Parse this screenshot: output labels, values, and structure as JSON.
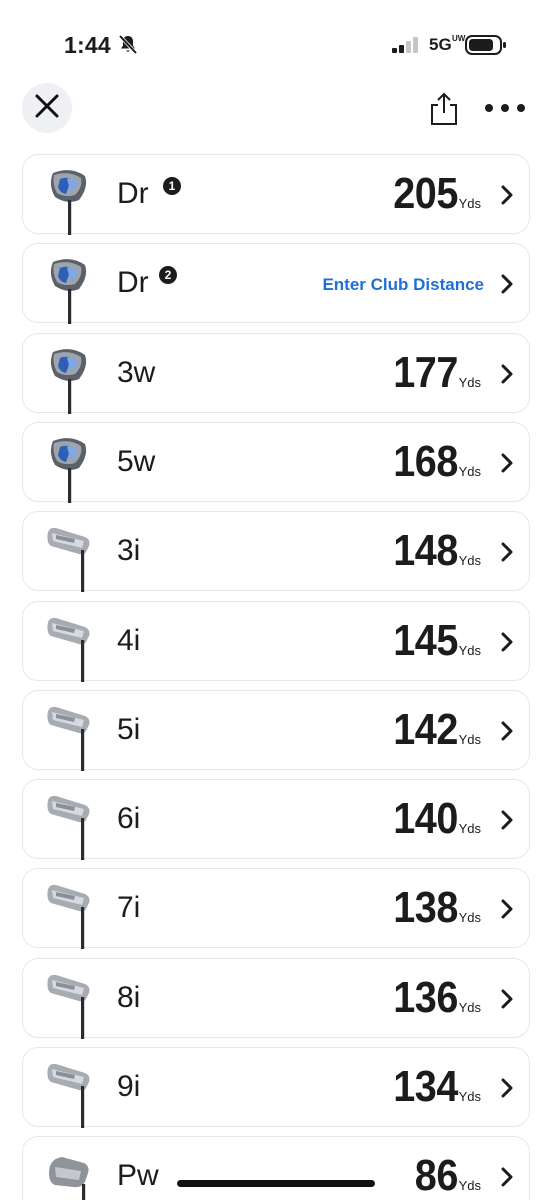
{
  "status_bar": {
    "time": "1:44",
    "network": "5G",
    "network_sup": "UW",
    "icons": [
      "bell-slash-icon",
      "signal-icon",
      "battery-icon"
    ]
  },
  "nav": {
    "icons": [
      "close-icon",
      "share-icon",
      "more-icon"
    ]
  },
  "colors": {
    "link": "#1f6fd6",
    "row_border": "#e6e8ec",
    "close_bg": "#eef0f4",
    "text": "#1c1c1e"
  },
  "clubs": [
    {
      "name": "Dr",
      "badge": "1",
      "type": "driver",
      "distance": "205",
      "unit": "Yds",
      "link": ""
    },
    {
      "name": "Dr",
      "badge": "2",
      "type": "driver",
      "distance": "",
      "unit": "",
      "link": "Enter Club Distance"
    },
    {
      "name": "3w",
      "badge": "",
      "type": "driver",
      "distance": "177",
      "unit": "Yds",
      "link": ""
    },
    {
      "name": "5w",
      "badge": "",
      "type": "driver",
      "distance": "168",
      "unit": "Yds",
      "link": ""
    },
    {
      "name": "3i",
      "badge": "",
      "type": "iron",
      "distance": "148",
      "unit": "Yds",
      "link": ""
    },
    {
      "name": "4i",
      "badge": "",
      "type": "iron",
      "distance": "145",
      "unit": "Yds",
      "link": ""
    },
    {
      "name": "5i",
      "badge": "",
      "type": "iron",
      "distance": "142",
      "unit": "Yds",
      "link": ""
    },
    {
      "name": "6i",
      "badge": "",
      "type": "iron",
      "distance": "140",
      "unit": "Yds",
      "link": ""
    },
    {
      "name": "7i",
      "badge": "",
      "type": "iron",
      "distance": "138",
      "unit": "Yds",
      "link": ""
    },
    {
      "name": "8i",
      "badge": "",
      "type": "iron",
      "distance": "136",
      "unit": "Yds",
      "link": ""
    },
    {
      "name": "9i",
      "badge": "",
      "type": "iron",
      "distance": "134",
      "unit": "Yds",
      "link": ""
    },
    {
      "name": "Pw",
      "badge": "",
      "type": "wedge",
      "distance": "86",
      "unit": "Yds",
      "link": ""
    }
  ]
}
